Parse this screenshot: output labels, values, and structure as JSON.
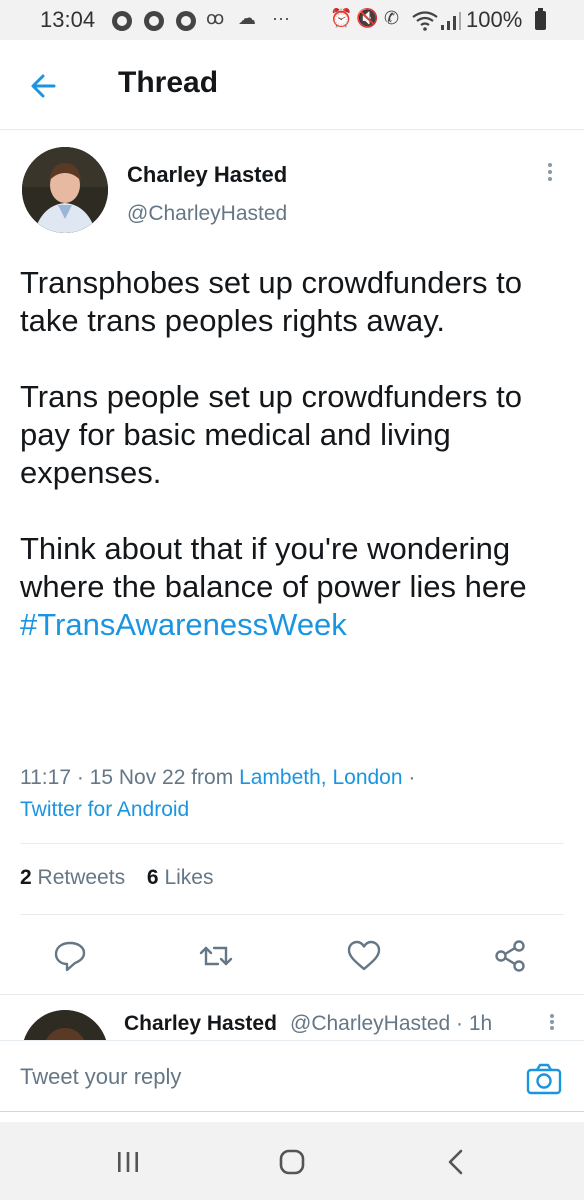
{
  "status_bar": {
    "time": "13:04",
    "battery": "100%"
  },
  "header": {
    "title": "Thread"
  },
  "tweet": {
    "author_name": "Charley Hasted",
    "author_handle": "@CharleyHasted",
    "paragraph_1": "Transphobes set up crowdfunders to take trans peoples rights away.",
    "paragraph_2": "Trans people set up crowdfunders to pay for basic medical and living expenses.",
    "paragraph_3": "Think about that if you're wondering where the balance of power lies here",
    "hashtag": "#TransAwarenessWeek",
    "timestamp": "11:17 · 15 Nov 22 from ",
    "location": "Lambeth, London",
    "location_suffix": " ·",
    "source": "Twitter for Android",
    "retweets_count": "2",
    "retweets_label": "Retweets",
    "likes_count": "6",
    "likes_label": "Likes"
  },
  "reply_preview": {
    "author_name": "Charley Hasted",
    "author_handle": "@CharleyHasted · 1h"
  },
  "composer": {
    "placeholder": "Tweet your reply"
  },
  "colors": {
    "accent": "#1b95e0",
    "secondary_text": "#657786",
    "primary_text": "#14171a"
  }
}
